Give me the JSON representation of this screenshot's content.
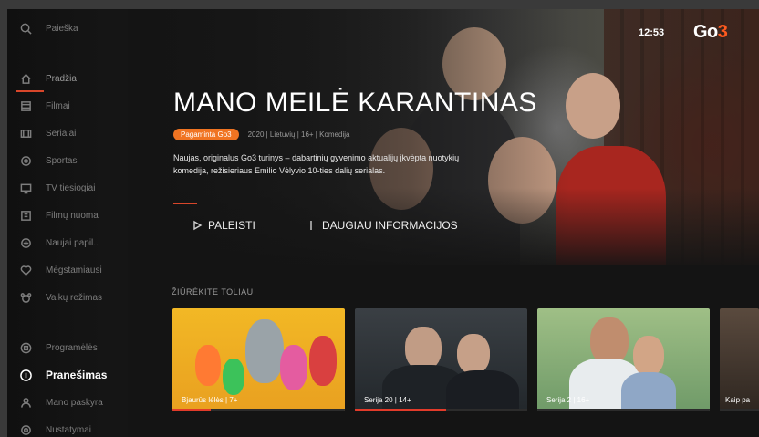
{
  "sidebar": {
    "search": "Paieška",
    "items": [
      {
        "label": "Pradžia",
        "icon": "home-icon"
      },
      {
        "label": "Filmai",
        "icon": "film-icon"
      },
      {
        "label": "Serialai",
        "icon": "series-icon"
      },
      {
        "label": "Sportas",
        "icon": "sport-icon"
      },
      {
        "label": "TV tiesiogiai",
        "icon": "tv-icon"
      },
      {
        "label": "Filmų nuoma",
        "icon": "rent-icon"
      },
      {
        "label": "Naujai papil..",
        "icon": "new-icon"
      },
      {
        "label": "Mėgstamiausi",
        "icon": "heart-icon"
      },
      {
        "label": "Vaikų režimas",
        "icon": "kids-icon"
      }
    ],
    "bottom": [
      {
        "label": "Programėlės",
        "icon": "apps-icon"
      },
      {
        "label": "Pranešimas",
        "icon": "notification-icon"
      },
      {
        "label": "Mano paskyra",
        "icon": "user-icon"
      },
      {
        "label": "Nustatymai",
        "icon": "settings-icon"
      }
    ]
  },
  "header": {
    "time": "12:53",
    "logo": "Go",
    "logo_accent": "3"
  },
  "hero": {
    "title": "MANO MEILĖ KARANTINAS",
    "badge": "Pagaminta Go3",
    "meta": "2020 | Lietuvių | 16+ | Komedija",
    "description": "Naujas, originalus Go3 turinys – dabartinių gyvenimo aktualijų įkvėpta nuotykių komedija, režisieriaus Emilio Vėlyvio 10-ties dalių serialas.",
    "play": "PALEISTI",
    "more_info": "DAUGIAU INFORMACIJOS"
  },
  "continue": {
    "title": "ŽIŪRĖKITE TOLIAU",
    "cards": [
      {
        "label": "Bjaurūs lėlės | 7+",
        "progress": 0.22
      },
      {
        "label": "Serija 20 | 14+",
        "progress": 0.53
      },
      {
        "label": "Serija 2 | 16+",
        "progress": 0.0
      },
      {
        "label": "Kaip pa",
        "progress": 0.0
      }
    ]
  },
  "colors": {
    "accent": "#f07422",
    "progress": "#e23b2a",
    "bg": "#141414"
  }
}
